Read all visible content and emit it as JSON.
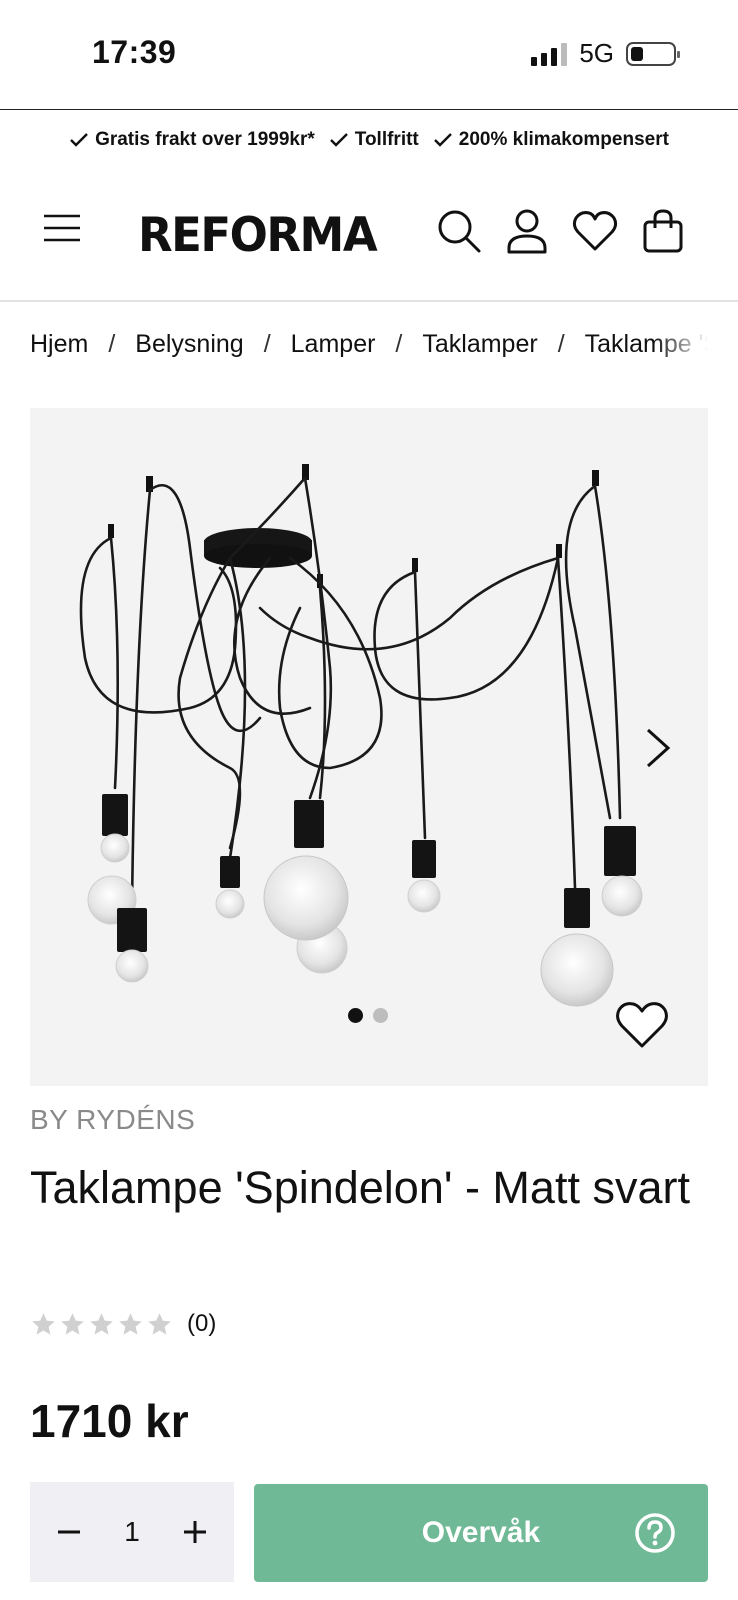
{
  "status_bar": {
    "time": "17:39",
    "network": "5G",
    "battery_level": 0.3
  },
  "usp": [
    {
      "icon": "check-icon",
      "label": "Gratis frakt over 1999kr*"
    },
    {
      "icon": "check-icon",
      "label": "Tollfritt"
    },
    {
      "icon": "check-icon",
      "label": "200% klimakompensert"
    }
  ],
  "header": {
    "logo": "REFORMA",
    "icons": [
      "menu-icon",
      "search-icon",
      "account-icon",
      "wishlist-icon",
      "cart-icon"
    ]
  },
  "breadcrumb": [
    "Hjem",
    "Belysning",
    "Lamper",
    "Taklamper",
    "Taklampe 'Spindelon' - Matt svart"
  ],
  "gallery": {
    "image_count": 2,
    "active_index": 0
  },
  "product": {
    "brand": "BY RYDÉNS",
    "title": "Taklampe 'Spindelon' - Matt svart",
    "rating": 0,
    "rating_count": "(0)",
    "price": "1710 kr"
  },
  "purchase": {
    "quantity": "1",
    "button_label": "Overvåk"
  },
  "colors": {
    "button": "#6fb996",
    "qty_bg": "#efeff4",
    "image_bg": "#f3f3f3"
  }
}
